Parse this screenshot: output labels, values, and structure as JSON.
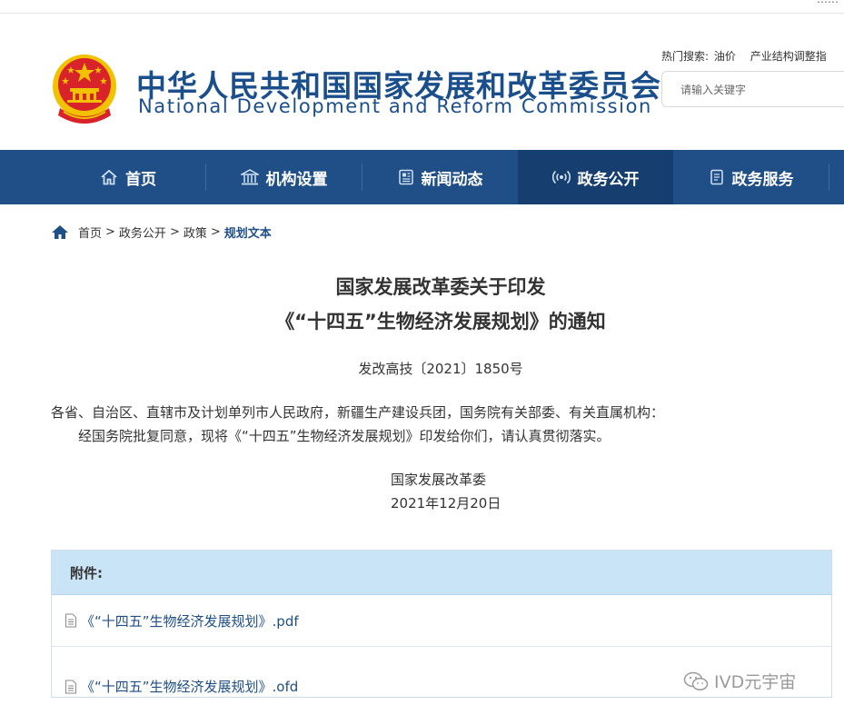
{
  "top_bar": {
    "text": "……"
  },
  "header": {
    "title_cn": "中华人民共和国国家发展和改革委员会",
    "title_en": "National Development and Reform Commission",
    "emblem_icon": "national-emblem-icon",
    "hot_search_label": "热门搜索:",
    "hot_keywords": [
      "油价",
      "产业结构调整指"
    ],
    "search_placeholder": "请输入关键字"
  },
  "nav": {
    "items": [
      {
        "label": "首页",
        "icon": "home-outline-icon"
      },
      {
        "label": "机构设置",
        "icon": "building-icon"
      },
      {
        "label": "新闻动态",
        "icon": "newspaper-icon"
      },
      {
        "label": "政务公开",
        "icon": "broadcast-icon",
        "active": true
      },
      {
        "label": "政务服务",
        "icon": "document-icon"
      }
    ]
  },
  "breadcrumb": {
    "items": [
      "首页",
      "政务公开",
      "政策",
      "规划文本"
    ],
    "separator": ">"
  },
  "article": {
    "title_line1": "国家发展改革委关于印发",
    "title_line2": "《“十四五”生物经济发展规划》的通知",
    "doc_number": "发改高技〔2021〕1850号",
    "paragraph1": "各省、自治区、直辖市及计划单列市人民政府，新疆生产建设兵团，国务院有关部委、有关直属机构：",
    "paragraph2": "经国务院批复同意，现将《“十四五”生物经济发展规划》印发给你们，请认真贯彻落实。",
    "signer": "国家发展改革委",
    "date": "2021年12月20日"
  },
  "attachments": {
    "heading": "附件:",
    "files": [
      {
        "name": "《“十四五”生物经济发展规划》.pdf",
        "icon": "file-icon"
      },
      {
        "name": "《“十四五”生物经济发展规划》.ofd",
        "icon": "file-icon"
      }
    ]
  },
  "watermark": {
    "text": "IVD元宇宙",
    "icon": "wechat-icon"
  },
  "colors": {
    "brand_blue": "#1a4f8c",
    "nav_bg": "#1f4f86",
    "nav_active": "#163f6f",
    "attachment_header": "#c9e3f7",
    "emblem_red": "#d8232a",
    "emblem_gold": "#f2c200"
  }
}
